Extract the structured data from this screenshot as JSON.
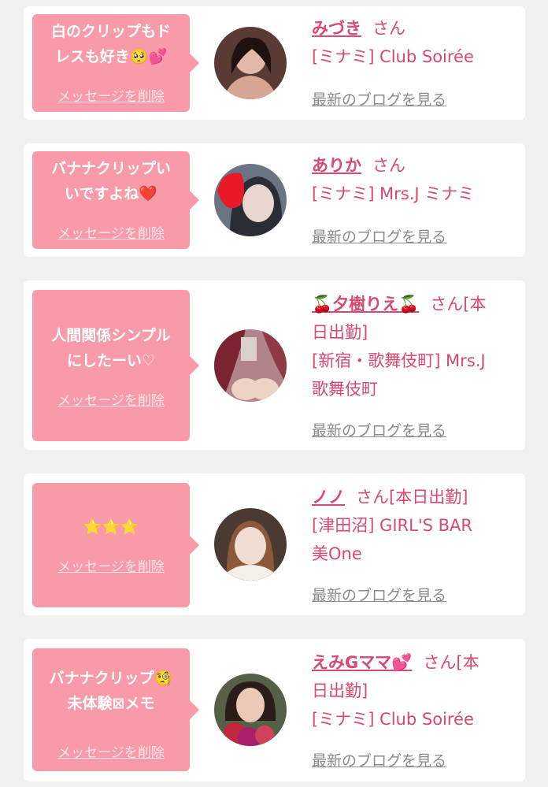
{
  "colors": {
    "bubble": "#f89aa8",
    "name": "#d9486f",
    "link": "#8a8a8a",
    "background": "#f1f0f1"
  },
  "common": {
    "delete_label": "メッセージを削除",
    "blog_label": "最新のブログを見る",
    "san": "さん"
  },
  "cards": [
    {
      "message_lines": [
        "白のクリップもド",
        "レスも好き🥺💕"
      ],
      "name": "みづき",
      "san_suffix": "さん",
      "shop_lines": [
        "[ミナミ] Club Soirée"
      ]
    },
    {
      "message_lines": [
        "バナナクリップい",
        "いですよね❤️"
      ],
      "name": "ありか",
      "san_suffix": "さん",
      "shop_lines": [
        "[ミナミ] Mrs.J ミナミ"
      ]
    },
    {
      "message_lines": [
        "人間関係シンプル",
        "にしたーい♡"
      ],
      "name": "🍒夕樹りえ🍒",
      "san_suffix": "さん[本",
      "name_line2": "日出勤]",
      "shop_lines": [
        "[新宿・歌舞伎町] Mrs.J",
        "歌舞伎町"
      ]
    },
    {
      "message_lines": [
        "⭐⭐⭐"
      ],
      "name": "ノノ",
      "san_suffix": "さん[本日出勤]",
      "shop_lines": [
        "[津田沼] GIRL'S BAR",
        "美One"
      ]
    },
    {
      "message_lines": [
        "バナナクリップ🧐",
        "未体験⊠メモ"
      ],
      "name": "えみGママ💕",
      "san_suffix": "さん[本",
      "name_line2": "日出勤]",
      "shop_lines": [
        "[ミナミ] Club Soirée"
      ]
    }
  ]
}
